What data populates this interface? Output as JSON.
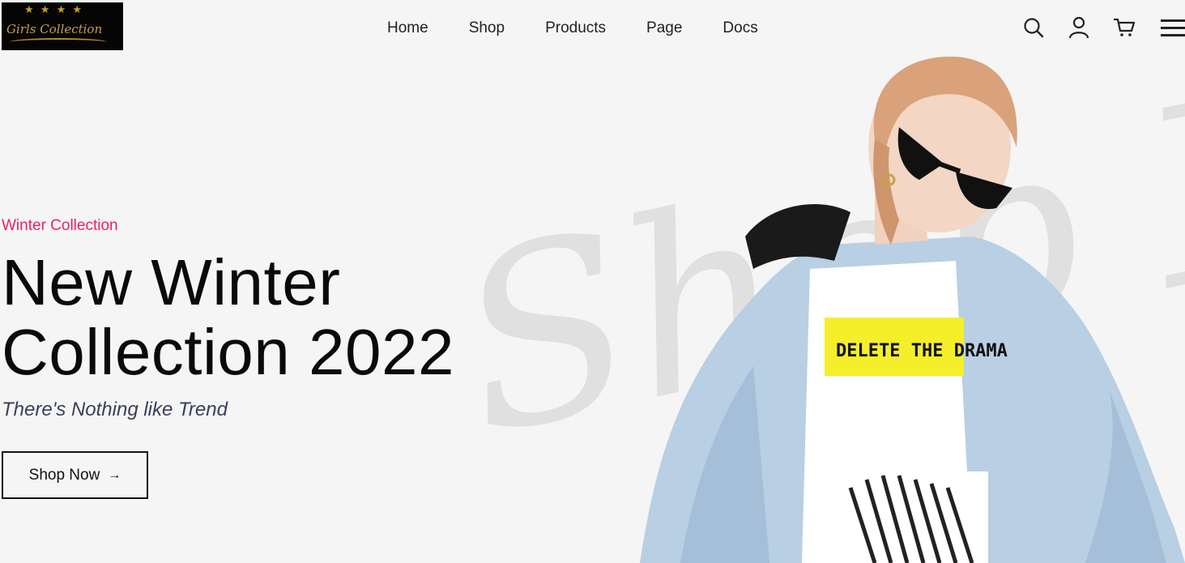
{
  "logo": {
    "text": "Girls Collection",
    "stars": "★ ★ ★ ★"
  },
  "nav": {
    "items": [
      "Home",
      "Shop",
      "Products",
      "Page",
      "Docs"
    ]
  },
  "icons": {
    "search": "search-icon",
    "user": "user-icon",
    "cart": "cart-icon",
    "menu": "hamburger-menu-icon"
  },
  "hero": {
    "eyebrow": "Winter Collection",
    "title_line1": "New Winter",
    "title_line2": "Collection 2022",
    "tagline": "There's Nothing like Trend",
    "cta_label": "Shop Now",
    "cta_arrow": "→",
    "background_script": "Shop It's",
    "shirt_text": "DELETE THE DRAMA"
  },
  "colors": {
    "accent": "#e8245b",
    "background": "#f5f5f5",
    "logo_gold": "#c9a04a"
  }
}
